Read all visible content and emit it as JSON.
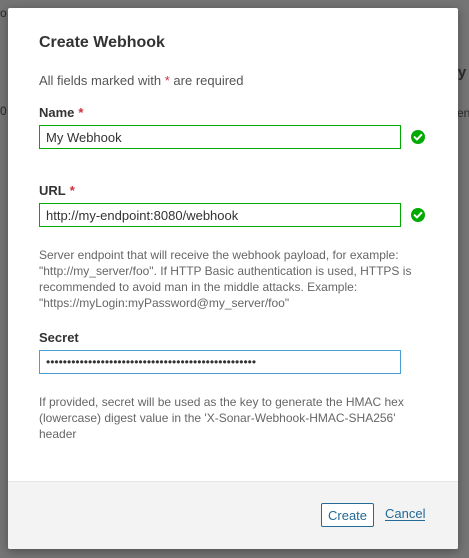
{
  "background": {
    "fragment_left_top": "o",
    "fragment_left": "0",
    "fragment_right_top": "ry",
    "fragment_right": "en"
  },
  "modal": {
    "title": "Create Webhook",
    "required_note_prefix": "All fields marked with",
    "required_note_star": "*",
    "required_note_suffix": "are required"
  },
  "name_field": {
    "label": "Name",
    "required_marker": "*",
    "value": "My Webhook",
    "valid_icon": "check-circle-icon"
  },
  "url_field": {
    "label": "URL",
    "required_marker": "*",
    "value": "http://my-endpoint:8080/webhook",
    "valid_icon": "check-circle-icon",
    "help_text": "Server endpoint that will receive the webhook payload, for example: \"http://my_server/foo\". If HTTP Basic authentication is used, HTTPS is recommended to avoid man in the middle attacks. Example: \"https://myLogin:myPassword@my_server/foo\""
  },
  "secret_field": {
    "label": "Secret",
    "value": "••••••••••••••••••••••••••••••••••••••••••••••••••",
    "help_text": "If provided, secret will be used as the key to generate the HMAC hex (lowercase) digest value in the 'X-Sonar-Webhook-HMAC-SHA256' header"
  },
  "footer": {
    "create_label": "Create",
    "cancel_label": "Cancel"
  },
  "colors": {
    "valid_green": "#00aa00",
    "link_blue": "#236a97",
    "required_red": "#d02f3a",
    "focus_blue": "#4b9fd5"
  }
}
